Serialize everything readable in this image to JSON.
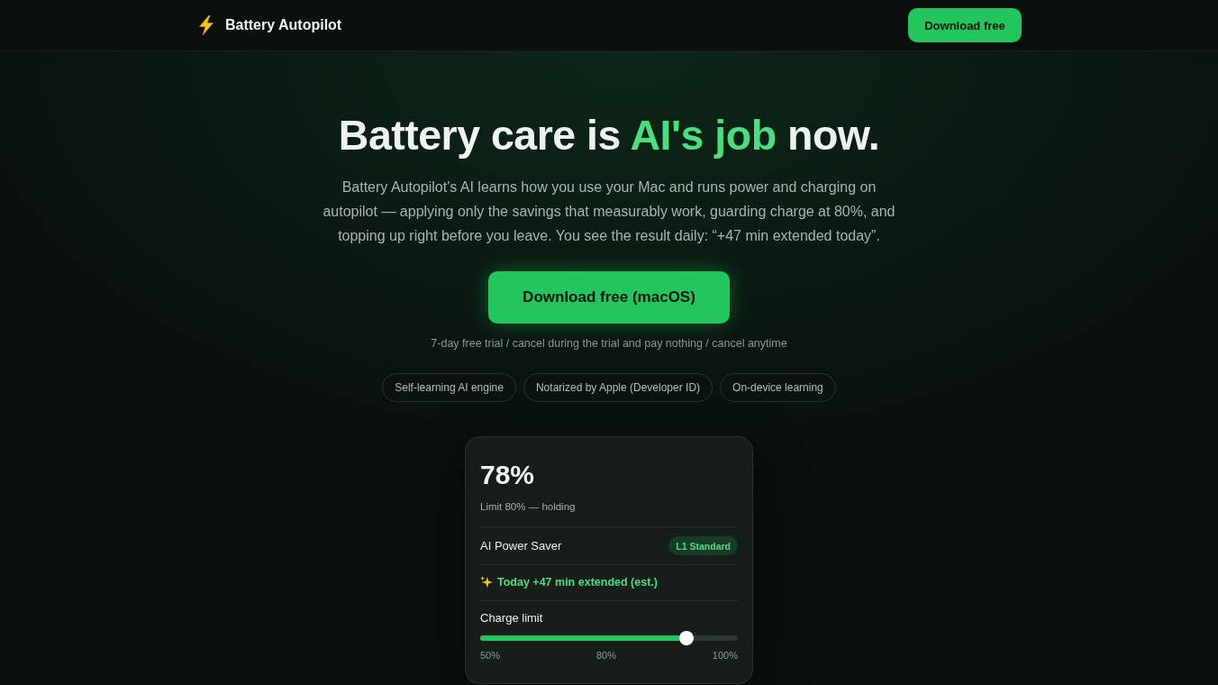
{
  "nav": {
    "brand": "Battery Autopilot",
    "cta": "Download free"
  },
  "hero": {
    "headline": [
      {
        "text": "Battery care is ",
        "highlight": false
      },
      {
        "text": "AI's job",
        "highlight": true
      },
      {
        "text": " now.",
        "highlight": false
      }
    ],
    "description": "Battery Autopilot's AI learns how you use your Mac and runs power and charging on autopilot — applying only the savings that measurably work, guarding charge at 80%, and topping up right before you leave. You see the result daily: “+47 min extended today”.",
    "cta": "Download free (macOS)",
    "note": "7-day free trial / cancel during the trial and pay nothing / cancel anytime",
    "badges": [
      "Self-learning AI engine",
      "Notarized by Apple (Developer ID)",
      "On-device learning"
    ]
  },
  "status_card": {
    "charge": "78%",
    "status": "Limit 80% — holding",
    "mode": {
      "label": "AI Power Saver",
      "badge": "L1 Standard"
    },
    "savings": "Today +47 min extended (est.)",
    "charge_limit": {
      "label": "Charge limit",
      "level": 0.8,
      "scale": [
        "50%",
        "80%",
        "100%"
      ]
    }
  }
}
